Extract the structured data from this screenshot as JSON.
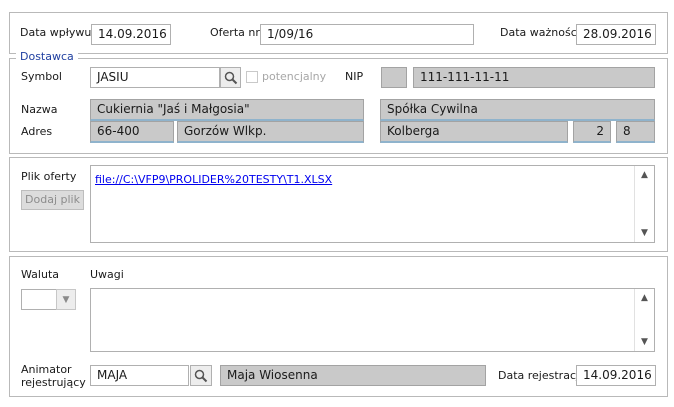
{
  "header": {
    "data_wplywu_label": "Data wpływu",
    "data_wplywu_value": "14.09.2016",
    "oferta_nr_label": "Oferta nr",
    "oferta_nr_value": "1/09/16",
    "data_waznosci_label": "Data ważności",
    "data_waznosci_value": "28.09.2016"
  },
  "dostawca": {
    "section_title": "Dostawca",
    "symbol_label": "Symbol",
    "symbol_value": "JASIU",
    "potencjalny_label": "potencjalny",
    "nip_label": "NIP",
    "nip_prefix": "",
    "nip_value": "111-111-11-11",
    "nazwa_label": "Nazwa",
    "nazwa_value": "Cukiernia \"Jaś i Małgosia\"",
    "nazwa_value2": "Spółka Cywilna",
    "adres_label": "Adres",
    "kod": "66-400",
    "miasto": "Gorzów Wlkp.",
    "ulica": "Kolberga",
    "nr_domu": "2",
    "nr_lokalu": "8"
  },
  "plik": {
    "label": "Plik oferty",
    "dodaj_label": "Dodaj plik",
    "path": "file://C:\\VFP9\\PROLIDER%20TESTY\\T1.XLSX"
  },
  "bottom": {
    "waluta_label": "Waluta",
    "waluta_value": "",
    "uwagi_label": "Uwagi",
    "uwagi_value": "",
    "animator_label_1": "Animator",
    "animator_label_2": "rejestrujący",
    "animator_symbol": "MAJA",
    "animator_name": "Maja Wiosenna",
    "data_rejestracji_label": "Data rejestracji",
    "data_rejestracji_value": "14.09.2016"
  }
}
